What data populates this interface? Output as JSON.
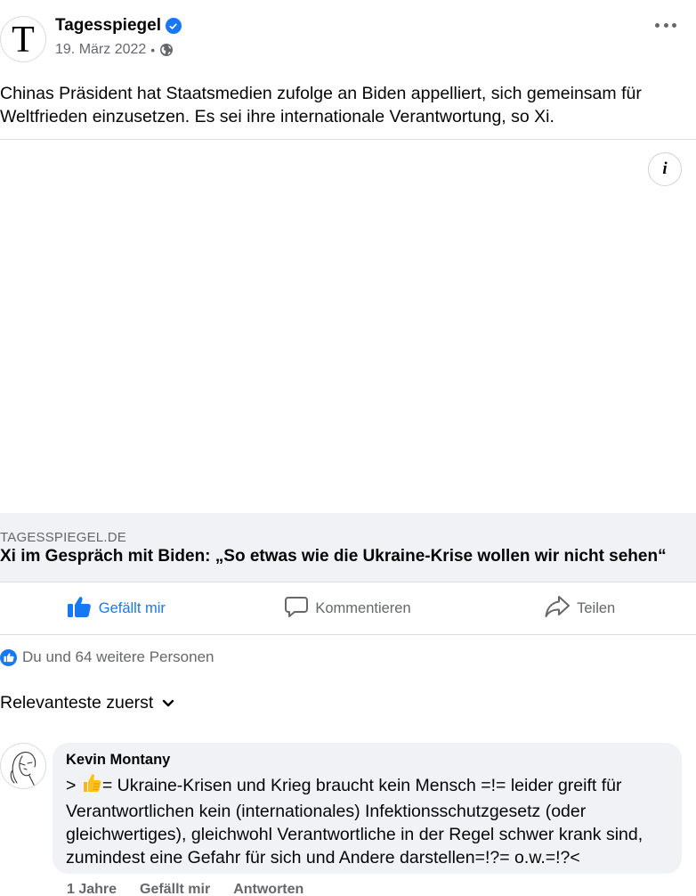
{
  "post": {
    "page_name": "Tagesspiegel",
    "avatar_letter": "T",
    "date": "19. März 2022",
    "separator": "•",
    "privacy_icon": "globe-icon",
    "text": "Chinas Präsident hat Staatsmedien zufolge an Biden appelliert, sich gemeinsam für Weltfrieden einzusetzen. Es sei ihre internationale Verantwortung, so Xi."
  },
  "media": {
    "info_label": "i"
  },
  "link": {
    "domain": "TAGESSPIEGEL.DE",
    "title": "Xi im Gespräch mit Biden: „So etwas wie die Ukraine-Krise wollen wir nicht sehen“"
  },
  "actions": {
    "like_label": "Gefällt mir",
    "comment_label": "Kommentieren",
    "share_label": "Teilen",
    "like_active": true
  },
  "reactions": {
    "summary": "Du und 64 weitere Personen"
  },
  "comments": {
    "sort_label": "Relevanteste zuerst",
    "items": [
      {
        "author": "Kevin Montany",
        "prefix": "> ",
        "emoji": "thumbs-up",
        "text": "= Ukraine-Krisen und Krieg braucht kein Mensch =!= leider greift für Verantwortlichen kein (internationales) Infektionsschutzgesetz (oder gleichwertiges), gleichwohl Verantwortliche in der Regel schwer krank sind, zumindest eine Gefahr für sich und Andere darstellen=!?= o.w.=!?<",
        "time": "1 Jahre",
        "like_label": "Gefällt mir",
        "reply_label": "Antworten"
      }
    ]
  },
  "colors": {
    "accent": "#1877f2",
    "muted": "#65676b",
    "surface": "#f0f2f5",
    "divider": "#dadde1"
  }
}
